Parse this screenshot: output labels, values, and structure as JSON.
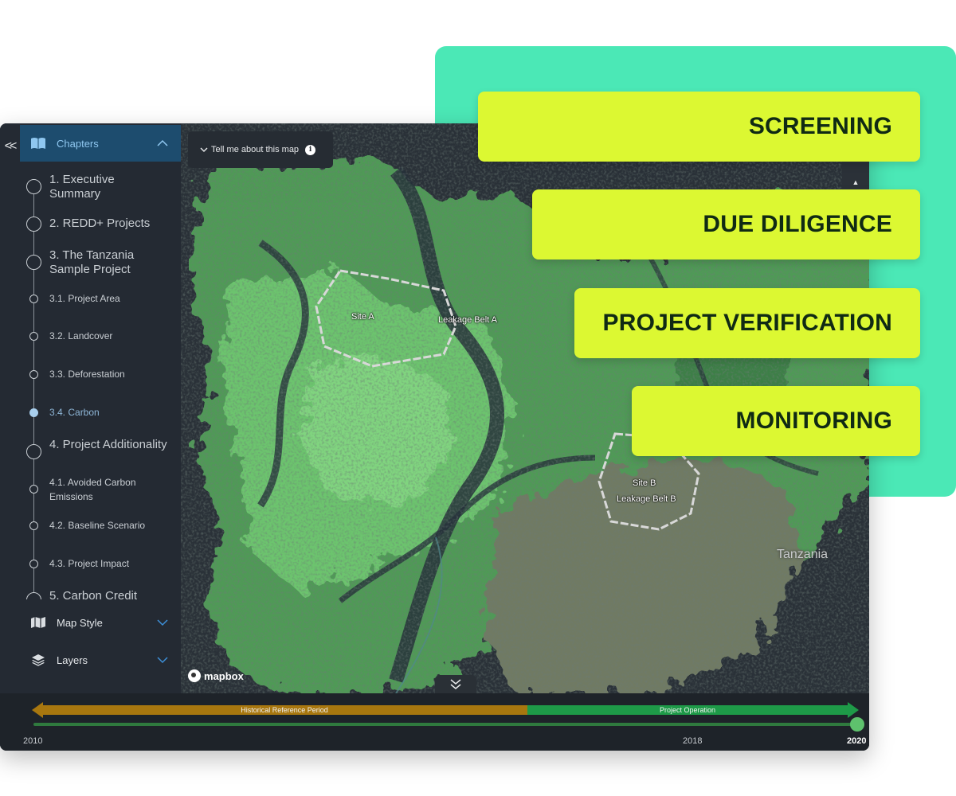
{
  "sidebar": {
    "collapse_icon": "double-chevron-left-icon",
    "collapse_label": "<<",
    "chapters_label": "Chapters",
    "toc": [
      {
        "label": "1. Executive Summary",
        "level": "main",
        "active": false
      },
      {
        "label": "2. REDD+ Projects",
        "level": "main",
        "active": false
      },
      {
        "label": "3. The Tanzania Sample Project",
        "level": "main",
        "active": false
      },
      {
        "label": "3.1. Project Area",
        "level": "sub",
        "active": false
      },
      {
        "label": "3.2. Landcover",
        "level": "sub",
        "active": false
      },
      {
        "label": "3.3. Deforestation",
        "level": "sub",
        "active": false
      },
      {
        "label": "3.4. Carbon",
        "level": "sub",
        "active": true
      },
      {
        "label": "4. Project Additionality",
        "level": "main",
        "active": false
      },
      {
        "label": "4.1. Avoided Carbon Emissions",
        "level": "sub",
        "active": false
      },
      {
        "label": "4.2. Baseline Scenario",
        "level": "sub",
        "active": false
      },
      {
        "label": "4.3. Project Impact",
        "level": "sub",
        "active": false
      },
      {
        "label": "5. Carbon Credit",
        "level": "main",
        "active": false
      }
    ],
    "map_style_label": "Map Style",
    "layers_label": "Layers"
  },
  "map": {
    "tell_me_label": "Tell me about this map",
    "info_glyph": "i",
    "labels": {
      "site_a": "Site A",
      "leakage_a": "Leakage Belt A",
      "site_b": "Site B",
      "leakage_b": "Leakage Belt B",
      "country": "Tanzania"
    },
    "attribution": "mapbox"
  },
  "timeline": {
    "historical_label": "Historical Reference Period",
    "operation_label": "Project Operation",
    "start_year": "2010",
    "mid_year": "2018",
    "end_year": "2020",
    "colors": {
      "historical": "#a8770f",
      "operation": "#1e9a48"
    }
  },
  "stages": [
    {
      "label": "SCREENING"
    },
    {
      "label": "DUE DILIGENCE"
    },
    {
      "label": "PROJECT VERIFICATION"
    },
    {
      "label": "MONITORING"
    }
  ],
  "colors": {
    "teal_card": "#4be8b6",
    "stage_tag": "#dcf832",
    "sidebar_active": "#1d4c6e"
  }
}
